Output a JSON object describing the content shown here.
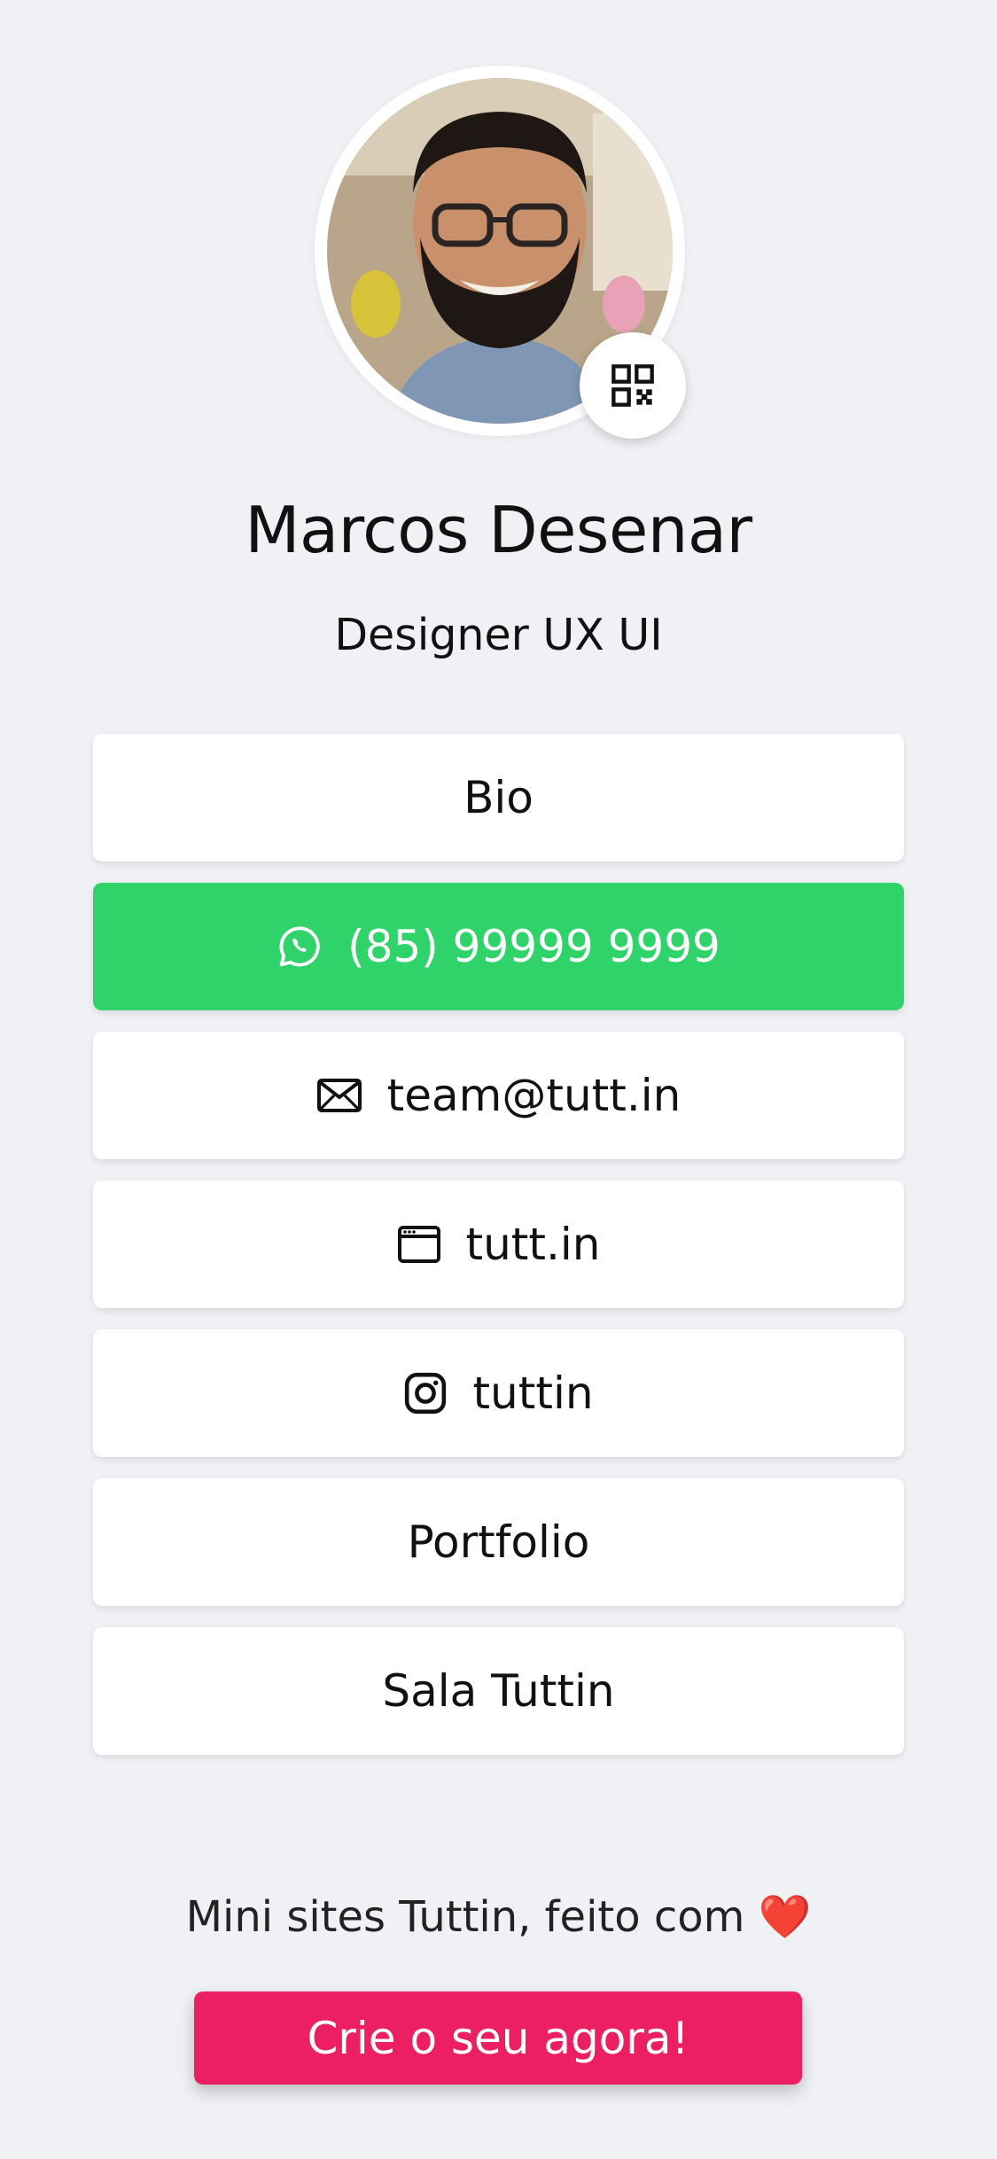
{
  "profile": {
    "name": "Marcos Desenar",
    "title": "Designer UX UI"
  },
  "links": {
    "bio": "Bio",
    "whatsapp": "(85) 99999 9999",
    "email": "team@tutt.in",
    "website": "tutt.in",
    "instagram": "tuttin",
    "portfolio": "Portfolio",
    "room": "Sala Tuttin"
  },
  "footer": {
    "text": "Mini sites Tuttin, feito com",
    "heart": "❤️",
    "cta": "Crie o seu agora!"
  },
  "icons": {
    "qr": "qr-code-icon",
    "whatsapp": "whatsapp-icon",
    "email": "envelope-icon",
    "website": "browser-window-icon",
    "instagram": "instagram-icon"
  },
  "colors": {
    "background": "#eff1f5",
    "whatsapp": "#2fd36a",
    "cta": "#ec1f63",
    "card": "#ffffff"
  }
}
